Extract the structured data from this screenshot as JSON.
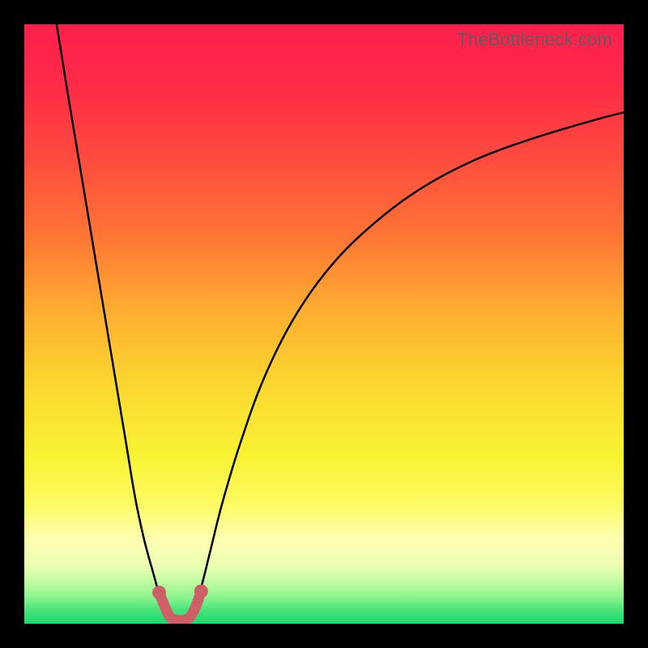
{
  "watermark": "TheBottleneck.com",
  "colors": {
    "frame": "#000000",
    "curve": "#000000",
    "marker": "#cf5f67",
    "gradient_stops": [
      {
        "offset": 0.0,
        "color": "#ff1f4d"
      },
      {
        "offset": 0.1,
        "color": "#ff2b47"
      },
      {
        "offset": 0.22,
        "color": "#ff4a3e"
      },
      {
        "offset": 0.35,
        "color": "#fe7435"
      },
      {
        "offset": 0.48,
        "color": "#feae30"
      },
      {
        "offset": 0.6,
        "color": "#fbd72f"
      },
      {
        "offset": 0.72,
        "color": "#f9f233"
      },
      {
        "offset": 0.8,
        "color": "#fcfb62"
      },
      {
        "offset": 0.86,
        "color": "#fdfeb1"
      },
      {
        "offset": 0.905,
        "color": "#e9feb1"
      },
      {
        "offset": 0.93,
        "color": "#c0fca1"
      },
      {
        "offset": 0.955,
        "color": "#8ef48e"
      },
      {
        "offset": 0.975,
        "color": "#4fe57b"
      },
      {
        "offset": 1.0,
        "color": "#17d96c"
      }
    ]
  },
  "chart_data": {
    "type": "line",
    "title": "",
    "xlabel": "",
    "ylabel": "",
    "xlim": [
      0,
      100
    ],
    "ylim": [
      0,
      100
    ],
    "grid": false,
    "legend": false,
    "series": [
      {
        "name": "left-curve",
        "x": [
          5.4,
          7,
          9,
          11,
          13,
          15,
          17,
          18.5,
          20,
          21.5,
          22.5,
          23.3,
          24,
          24.5
        ],
        "y": [
          100,
          90,
          78,
          66,
          54,
          42,
          30,
          21,
          14,
          8.5,
          5,
          3,
          1.5,
          0.8
        ]
      },
      {
        "name": "right-curve",
        "x": [
          27.5,
          28.3,
          29.5,
          31,
          33,
          36,
          40,
          45,
          51,
          58,
          66,
          75,
          85,
          95,
          100
        ],
        "y": [
          0.8,
          2.2,
          6,
          12,
          20,
          30,
          41,
          51,
          59.5,
          66.5,
          72.5,
          77.3,
          81,
          84,
          85.3
        ]
      },
      {
        "name": "valley-marker",
        "x": [
          22.5,
          23.3,
          24,
          24.6,
          25.5,
          26.5,
          27.4,
          28.1,
          28.8,
          29.5
        ],
        "y": [
          5.2,
          3.2,
          1.6,
          0.9,
          0.6,
          0.6,
          0.9,
          1.8,
          3.4,
          5.4
        ]
      }
    ],
    "annotations": [
      {
        "text": "TheBottleneck.com",
        "x": 98,
        "y": 99,
        "ha": "right",
        "va": "top"
      }
    ]
  }
}
